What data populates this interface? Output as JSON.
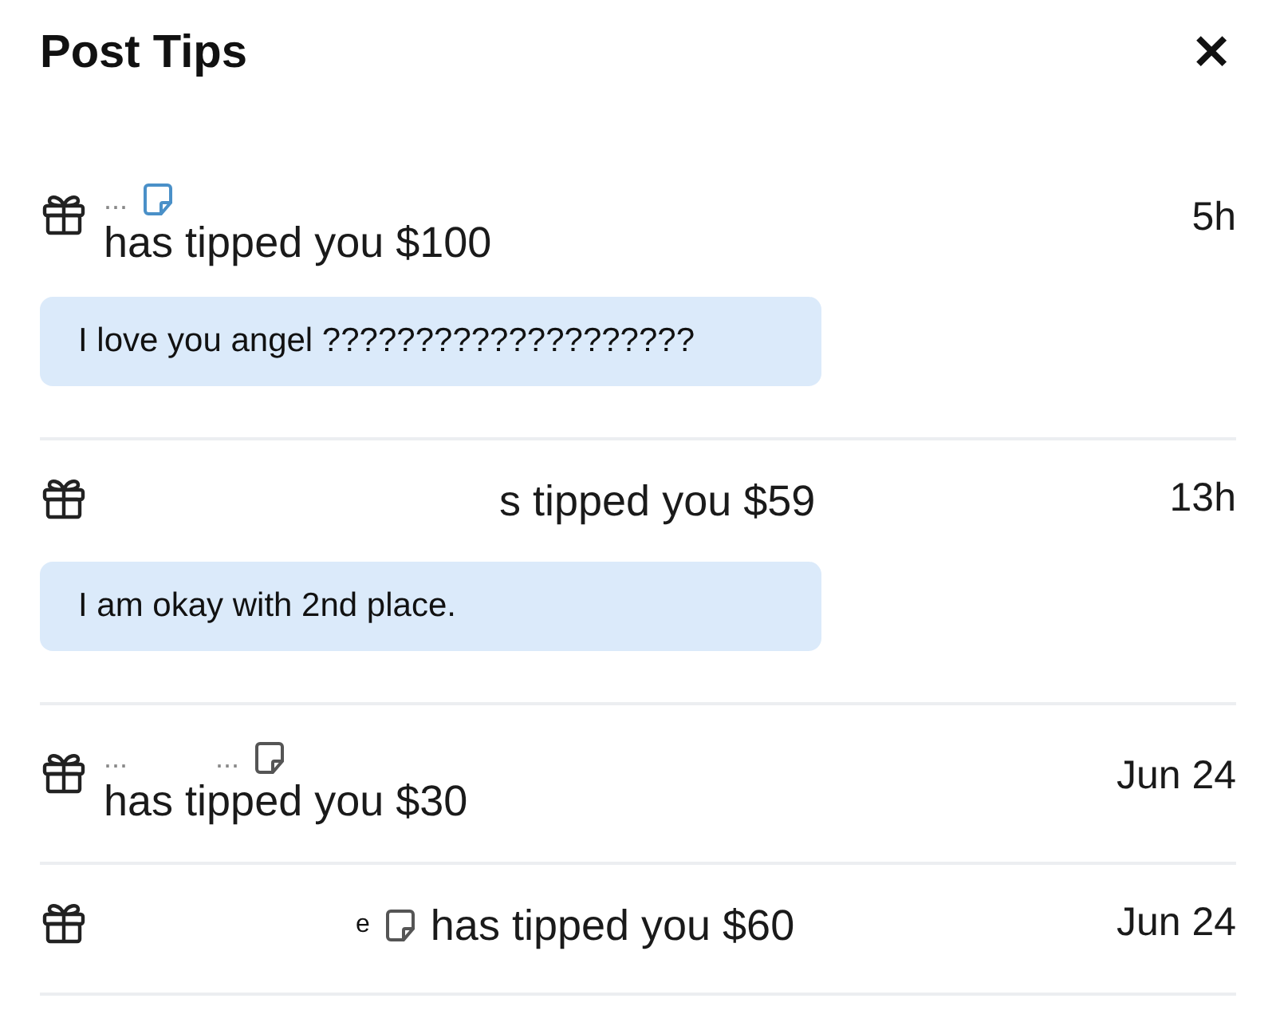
{
  "header": {
    "title": "Post Tips",
    "close": "✕"
  },
  "tips": [
    {
      "kind": "stacked",
      "name": "...",
      "color": "#4a90c8",
      "text": "has tipped you $100",
      "time": "5h",
      "message": "I love you angel ????????????????????"
    },
    {
      "kind": "inline",
      "text": "s tipped you $59",
      "time": "13h",
      "message": "I am okay with 2nd place."
    },
    {
      "kind": "stacked",
      "name": "...           ...",
      "color": "#555555",
      "text": "has tipped you $30",
      "time": "Jun 24"
    },
    {
      "kind": "inline",
      "name": "e",
      "color": "#555555",
      "text": "has tipped you $60",
      "time": "Jun 24"
    }
  ]
}
